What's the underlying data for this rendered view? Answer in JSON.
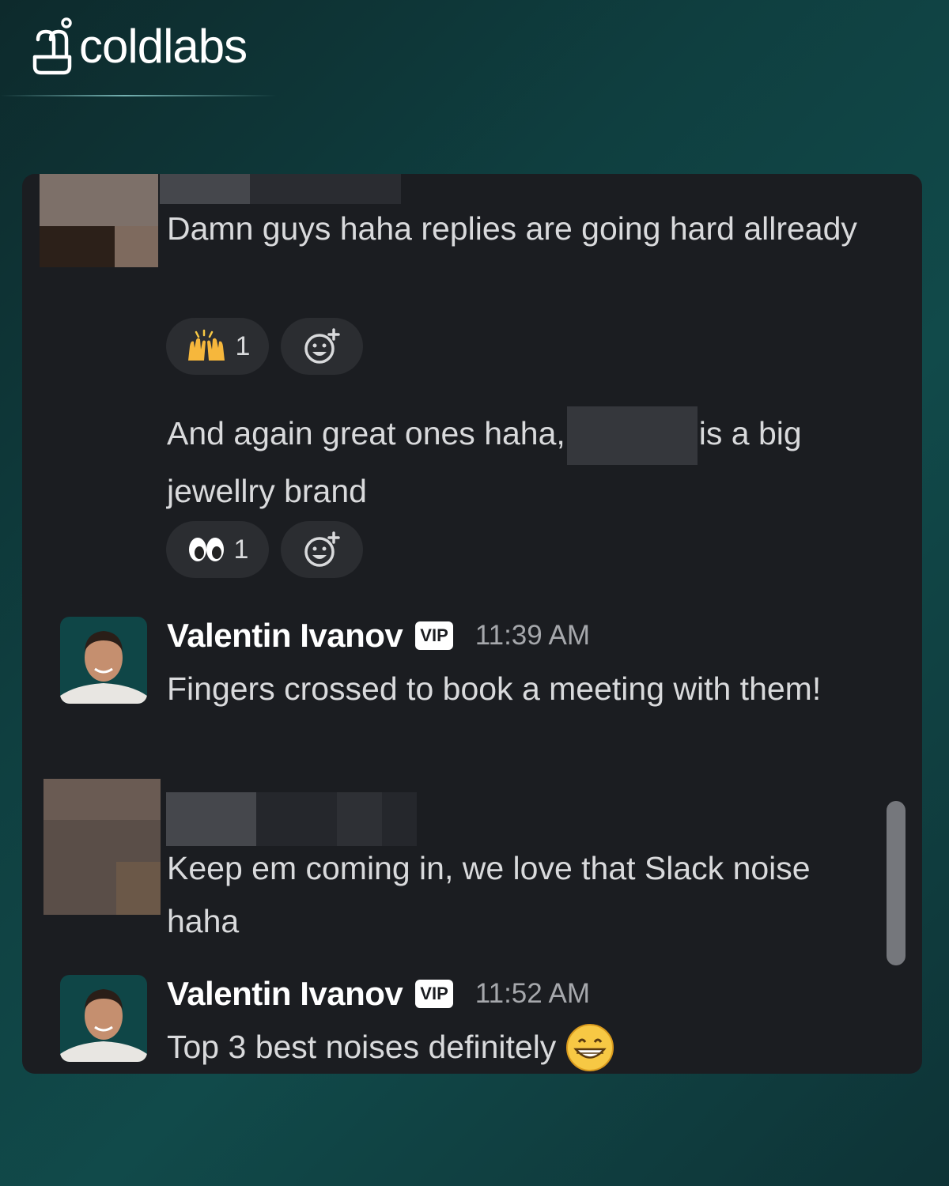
{
  "brand": {
    "name": "coldlabs",
    "logo_icon": "coldlabs-logo-icon"
  },
  "messages": [
    {
      "text": "Damn guys haha replies are going hard allready",
      "reactions": [
        {
          "emoji": "raising-hands",
          "count": "1"
        }
      ]
    },
    {
      "text_before": "And again great ones haha,",
      "text_after": "is a big jewellry brand",
      "reactions": [
        {
          "emoji": "eyes",
          "count": "1"
        }
      ]
    },
    {
      "author": "Valentin Ivanov",
      "badge": "VIP",
      "time": "11:39 AM",
      "text": "Fingers crossed to book a meeting with them!"
    },
    {
      "text": "Keep em coming in, we love that Slack noise haha"
    },
    {
      "author": "Valentin Ivanov",
      "badge": "VIP",
      "time": "11:52 AM",
      "text": "Top 3 best noises definitely",
      "emoji": "grinning-face"
    }
  ],
  "colors": {
    "panel_bg": "#1b1d21",
    "text": "#d9dadc",
    "reaction_bg": "#2b2d31"
  }
}
